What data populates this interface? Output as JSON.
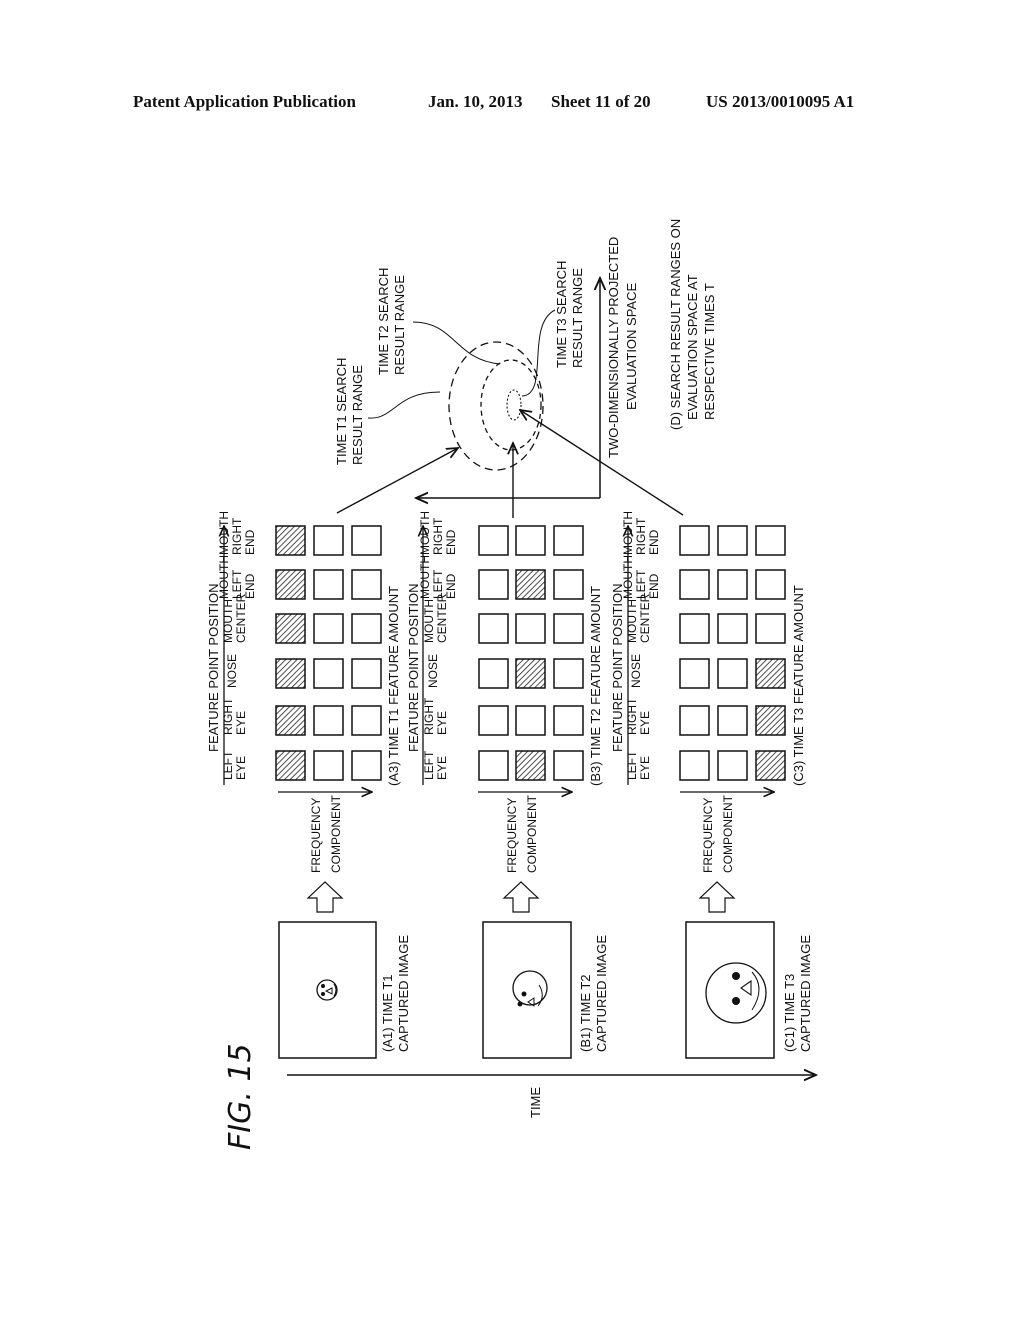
{
  "header": {
    "left": "Patent Application Publication",
    "date": "Jan. 10, 2013",
    "sheet": "Sheet 11 of 20",
    "number": "US 2013/0010095 A1"
  },
  "figure": {
    "title": "FIG. 15",
    "time_axis_label": "TIME",
    "frequency_label_1": "FREQUENCY",
    "frequency_label_2": "COMPONENT",
    "feature_point_position": "FEATURE POINT POSITION",
    "feature_points": [
      [
        "LEFT",
        "EYE"
      ],
      [
        "RIGHT",
        "EYE"
      ],
      [
        "NOSE"
      ],
      [
        "MOUTH",
        "CENTER"
      ],
      [
        "MOUTH",
        "LEFT",
        "END"
      ],
      [
        "MOUTH",
        "RIGHT",
        "END"
      ]
    ],
    "panels": [
      {
        "id": "A",
        "captured_caption_1": "(A1) TIME T1",
        "captured_caption_2": "CAPTURED IMAGE",
        "feature_caption": "(A3) TIME T1 FEATURE AMOUNT",
        "highlighted_frequency_index": [
          0,
          0,
          0,
          0,
          0,
          0
        ]
      },
      {
        "id": "B",
        "captured_caption_1": "(B1) TIME T2",
        "captured_caption_2": "CAPTURED IMAGE",
        "feature_caption": "(B3) TIME T2 FEATURE AMOUNT",
        "highlighted_frequency_index": [
          1,
          null,
          1,
          null,
          1,
          null
        ]
      },
      {
        "id": "C",
        "captured_caption_1": "(C1) TIME T3",
        "captured_caption_2": "CAPTURED IMAGE",
        "feature_caption": "(C3) TIME T3 FEATURE AMOUNT",
        "highlighted_frequency_index": [
          2,
          2,
          2,
          null,
          null,
          null
        ]
      }
    ],
    "evaluation_space": {
      "t1_label_1": "TIME T1 SEARCH",
      "t1_label_2": "RESULT RANGE",
      "t2_label_1": "TIME T2 SEARCH",
      "t2_label_2": "RESULT RANGE",
      "t3_label_1": "TIME T3 SEARCH",
      "t3_label_2": "RESULT RANGE",
      "space_label_1": "TWO-DIMENSIONALLY PROJECTED",
      "space_label_2": "EVALUATION SPACE",
      "caption_1": "(D) SEARCH RESULT RANGES ON",
      "caption_2": "EVALUATION SPACE AT",
      "caption_3": "RESPECTIVE TIMES T"
    }
  }
}
